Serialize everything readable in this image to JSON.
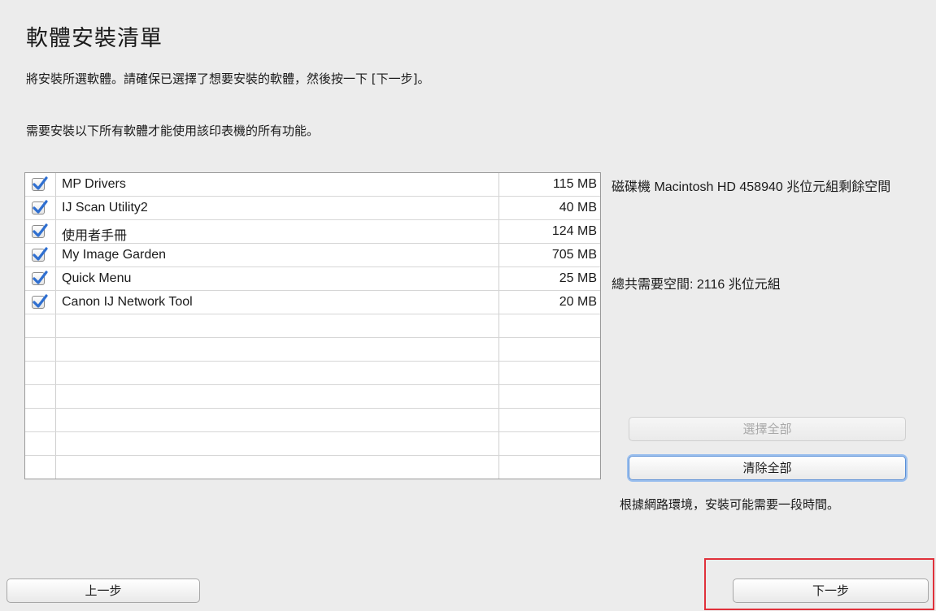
{
  "header": {
    "title": "軟體安裝清單",
    "instruction": "將安裝所選軟體。請確保已選擇了想要安裝的軟體，然後按一下 [下一步]。",
    "requirement": "需要安裝以下所有軟體才能使用該印表機的所有功能。"
  },
  "software": {
    "items": [
      {
        "name": "MP Drivers",
        "size": "115 MB",
        "checked": true
      },
      {
        "name": "IJ Scan Utility2",
        "size": "40 MB",
        "checked": true
      },
      {
        "name": "使用者手冊",
        "size": "124 MB",
        "checked": true
      },
      {
        "name": "My Image Garden",
        "size": "705 MB",
        "checked": true
      },
      {
        "name": "Quick Menu",
        "size": "25 MB",
        "checked": true
      },
      {
        "name": "Canon IJ Network Tool",
        "size": "20 MB",
        "checked": true
      }
    ]
  },
  "info": {
    "disk_space": "磁碟機 Macintosh HD 458940 兆位元組剩餘空間",
    "total_space": "總共需要空間: 2116 兆位元組"
  },
  "actions": {
    "select_all": "選擇全部",
    "clear_all": "清除全部",
    "network_note": "根據網路環境，安裝可能需要一段時間。"
  },
  "navigation": {
    "back": "上一步",
    "next": "下一步"
  },
  "colors": {
    "checkbox_blue": "#2f6fd0",
    "highlight_red": "#e0313b",
    "background": "#ececec"
  }
}
